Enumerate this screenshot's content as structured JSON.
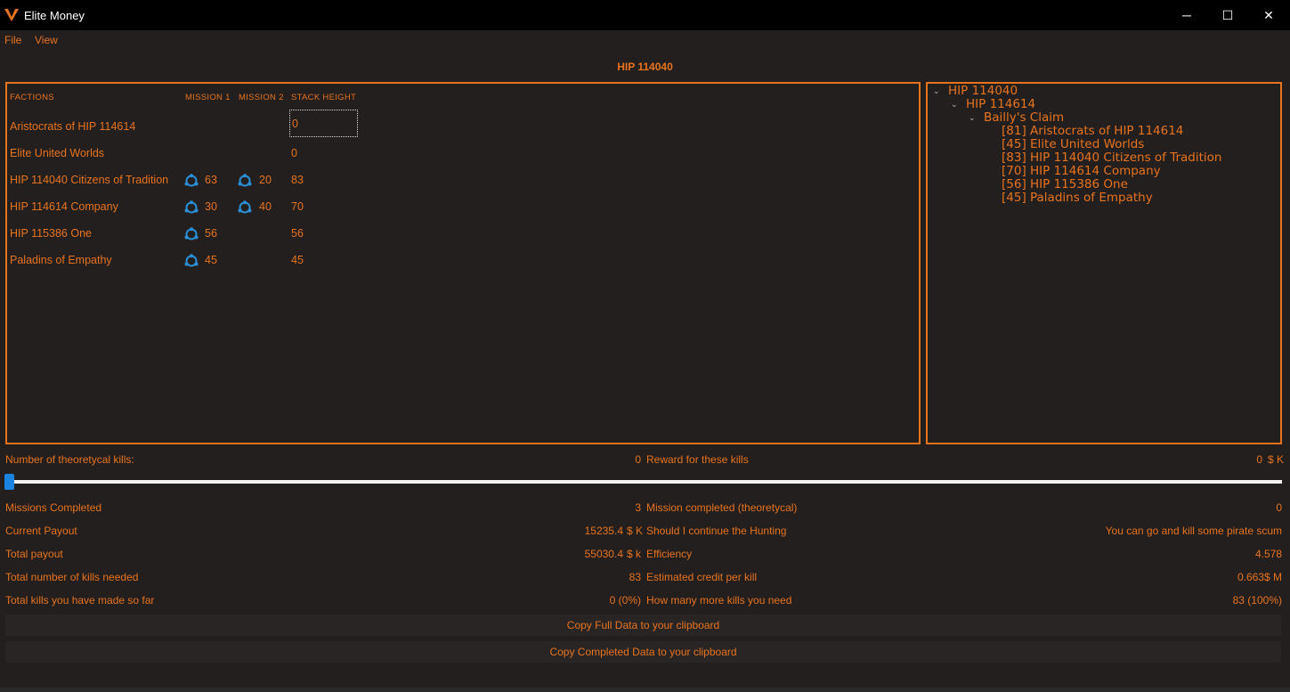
{
  "window": {
    "title": "Elite Money",
    "minimize_glyph": "─",
    "maximize_glyph": "☐",
    "close_glyph": "✕"
  },
  "menu": {
    "file": "File",
    "view": "View"
  },
  "system_title": "HIP 114040",
  "factions_table": {
    "headers": {
      "factions": "FACTIONS",
      "mission1": "MISSION 1",
      "mission2": "MISSION 2",
      "stack": "STACK HEIGHT"
    },
    "stack_input_value": "0",
    "rows": [
      {
        "name": "Aristocrats of HIP 114614",
        "m1": "",
        "m2": "",
        "stack": "0"
      },
      {
        "name": "Elite United Worlds",
        "m1": "",
        "m2": "",
        "stack": "0"
      },
      {
        "name": "HIP 114040 Citizens of Tradition",
        "m1": "63",
        "m2": "20",
        "stack": "83"
      },
      {
        "name": "HIP 114614 Company",
        "m1": "30",
        "m2": "40",
        "stack": "70"
      },
      {
        "name": "HIP 115386 One",
        "m1": "56",
        "m2": "",
        "stack": "56"
      },
      {
        "name": "Paladins of Empathy",
        "m1": "45",
        "m2": "",
        "stack": "45"
      }
    ],
    "mission_icon": "federation-icon",
    "icon_color": "#2a8fd6"
  },
  "tree": {
    "root": "HIP 114040",
    "system": "HIP 114614",
    "station": "Bailly's Claim",
    "leaves": [
      "[81] Aristocrats of HIP 114614",
      "[45] Elite United Worlds",
      "[83] HIP 114040 Citizens of Tradition",
      "[70] HIP 114614 Company",
      "[56] HIP 115386 One",
      "[45] Paladins of Empathy"
    ]
  },
  "kills": {
    "theoretical_label": "Number of theoretycal kills:",
    "theoretical_value": "0",
    "reward_label": "Reward for these kills",
    "reward_value": "0",
    "reward_unit": "$ K",
    "slider_value": 0
  },
  "stats_left": [
    {
      "label": "Missions Completed",
      "value": "3",
      "unit": ""
    },
    {
      "label": "Current Payout",
      "value": "15235.4",
      "unit": "$ K"
    },
    {
      "label": "Total payout",
      "value": "55030.4",
      "unit": "$ k"
    },
    {
      "label": "Total number of kills needed",
      "value": "83",
      "unit": ""
    },
    {
      "label": "Total kills you have made so far",
      "value": "0 (0%)",
      "unit": ""
    }
  ],
  "stats_right": [
    {
      "label": "Mission completed (theoretycal)",
      "value": "0"
    },
    {
      "label": "Should I continue the Hunting",
      "value": "You can go and kill some pirate scum"
    },
    {
      "label": "Efficiency",
      "value": "4.578"
    },
    {
      "label": "Estimated credit per kill",
      "value": "0.663$ M"
    },
    {
      "label": "How many more kills you need",
      "value": "83 (100%)"
    }
  ],
  "buttons": {
    "copy_full": "Copy Full Data to your clipboard",
    "copy_completed": "Copy Completed Data to your clipboard"
  },
  "colors": {
    "accent": "#e8731f",
    "background": "#231f1f",
    "slider": "#1a84e0"
  }
}
